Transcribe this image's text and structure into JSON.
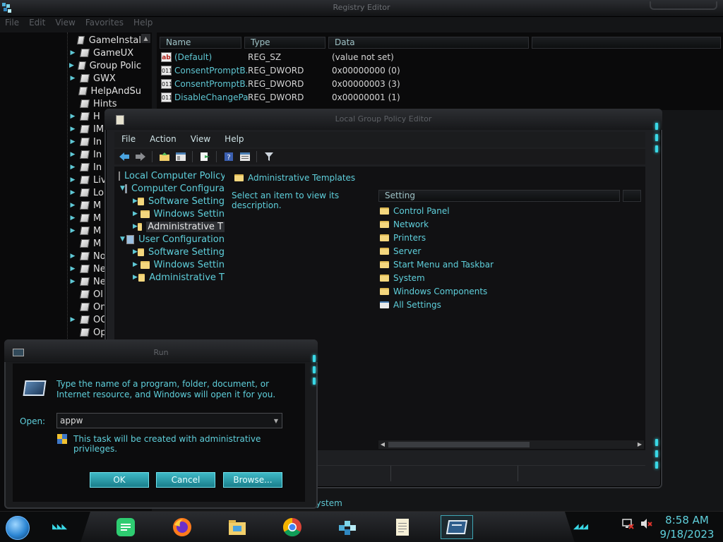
{
  "registry_editor": {
    "title": "Registry Editor",
    "menu": [
      "File",
      "Edit",
      "View",
      "Favorites",
      "Help"
    ],
    "tree_items": [
      {
        "label": "GameInstal",
        "expandable": false
      },
      {
        "label": "GameUX",
        "expandable": true
      },
      {
        "label": "Group Polic",
        "expandable": true
      },
      {
        "label": "GWX",
        "expandable": true
      },
      {
        "label": "HelpAndSu",
        "expandable": false
      },
      {
        "label": "Hints",
        "expandable": false
      },
      {
        "label": "H",
        "expandable": true
      },
      {
        "label": "IM",
        "expandable": true
      },
      {
        "label": "In",
        "expandable": true
      },
      {
        "label": "In",
        "expandable": true
      },
      {
        "label": "In",
        "expandable": true
      },
      {
        "label": "Liv",
        "expandable": true
      },
      {
        "label": "Lo",
        "expandable": true
      },
      {
        "label": "M",
        "expandable": true
      },
      {
        "label": "M",
        "expandable": true
      },
      {
        "label": "M",
        "expandable": true
      },
      {
        "label": "M",
        "expandable": false
      },
      {
        "label": "No",
        "expandable": true
      },
      {
        "label": "Ne",
        "expandable": true
      },
      {
        "label": "Ne",
        "expandable": true
      },
      {
        "label": "Ol",
        "expandable": false
      },
      {
        "label": "On",
        "expandable": false
      },
      {
        "label": "OO",
        "expandable": true
      },
      {
        "label": "Op",
        "expandable": false
      }
    ],
    "columns": [
      "Name",
      "Type",
      "Data"
    ],
    "values": [
      {
        "icon": "string-value-icon",
        "name": "(Default)",
        "type": "REG_SZ",
        "data": "(value not set)"
      },
      {
        "icon": "dword-value-icon",
        "name": "ConsentPromptB...",
        "type": "REG_DWORD",
        "data": "0x00000000 (0)"
      },
      {
        "icon": "dword-value-icon",
        "name": "ConsentPromptB...",
        "type": "REG_DWORD",
        "data": "0x00000003 (3)"
      },
      {
        "icon": "dword-value-icon",
        "name": "DisableChangePa...",
        "type": "REG_DWORD",
        "data": "0x00000001 (1)"
      }
    ],
    "status_path": "\\System"
  },
  "gpedit": {
    "title": "Local Group Policy Editor",
    "menu": [
      "File",
      "Action",
      "View",
      "Help"
    ],
    "toolbar": [
      "back-icon",
      "forward-icon",
      "up-folder-icon",
      "show-hide-tree-icon",
      "export-list-icon",
      "help-icon",
      "properties-icon",
      "filter-icon"
    ],
    "tree": [
      {
        "label": "Local Computer Policy",
        "level": 0,
        "expand": "",
        "icon": "policy-icon"
      },
      {
        "label": "Computer Configura",
        "level": 1,
        "expand": "▼",
        "icon": "computer-icon"
      },
      {
        "label": "Software Setting",
        "level": 2,
        "expand": "▶",
        "icon": "folder-icon"
      },
      {
        "label": "Windows Settin",
        "level": 2,
        "expand": "▶",
        "icon": "folder-icon"
      },
      {
        "label": "Administrative T",
        "level": 2,
        "expand": "▶",
        "icon": "folder-icon",
        "selected": true
      },
      {
        "label": "User Configuration",
        "level": 1,
        "expand": "▼",
        "icon": "user-icon"
      },
      {
        "label": "Software Setting",
        "level": 2,
        "expand": "▶",
        "icon": "folder-icon"
      },
      {
        "label": "Windows Settin",
        "level": 2,
        "expand": "▶",
        "icon": "folder-icon"
      },
      {
        "label": "Administrative T",
        "level": 2,
        "expand": "▶",
        "icon": "folder-icon"
      }
    ],
    "right_header": "Administrative Templates",
    "description": "Select an item to view its description.",
    "list_column": "Setting",
    "settings": [
      {
        "label": "Control Panel",
        "icon": "folder-icon"
      },
      {
        "label": "Network",
        "icon": "folder-icon"
      },
      {
        "label": "Printers",
        "icon": "folder-icon"
      },
      {
        "label": "Server",
        "icon": "folder-icon"
      },
      {
        "label": "Start Menu and Taskbar",
        "icon": "folder-icon"
      },
      {
        "label": "System",
        "icon": "folder-icon"
      },
      {
        "label": "Windows Components",
        "icon": "folder-icon"
      },
      {
        "label": "All Settings",
        "icon": "all-settings-icon"
      }
    ]
  },
  "run_dialog": {
    "title": "Run",
    "message": "Type the name of a program, folder, document, or Internet resource, and Windows will open it for you.",
    "open_label": "Open:",
    "open_value": "appw",
    "admin_note": "This task will be created with administrative privileges.",
    "ok_label": "OK",
    "cancel_label": "Cancel",
    "browse_label": "Browse..."
  },
  "taskbar": {
    "pinned": [
      "notes-app-icon",
      "firefox-icon",
      "file-explorer-icon",
      "chrome-icon",
      "registry-editor-icon",
      "notepad-icon",
      "run-icon"
    ],
    "time": "8:58 AM",
    "date": "9/18/2023",
    "tray": [
      "network-disconnected-icon",
      "volume-muted-icon"
    ]
  },
  "colors": {
    "accent": "#39d8e6",
    "text_cyan": "#5fd0dc",
    "background": "#0b0c0e"
  }
}
